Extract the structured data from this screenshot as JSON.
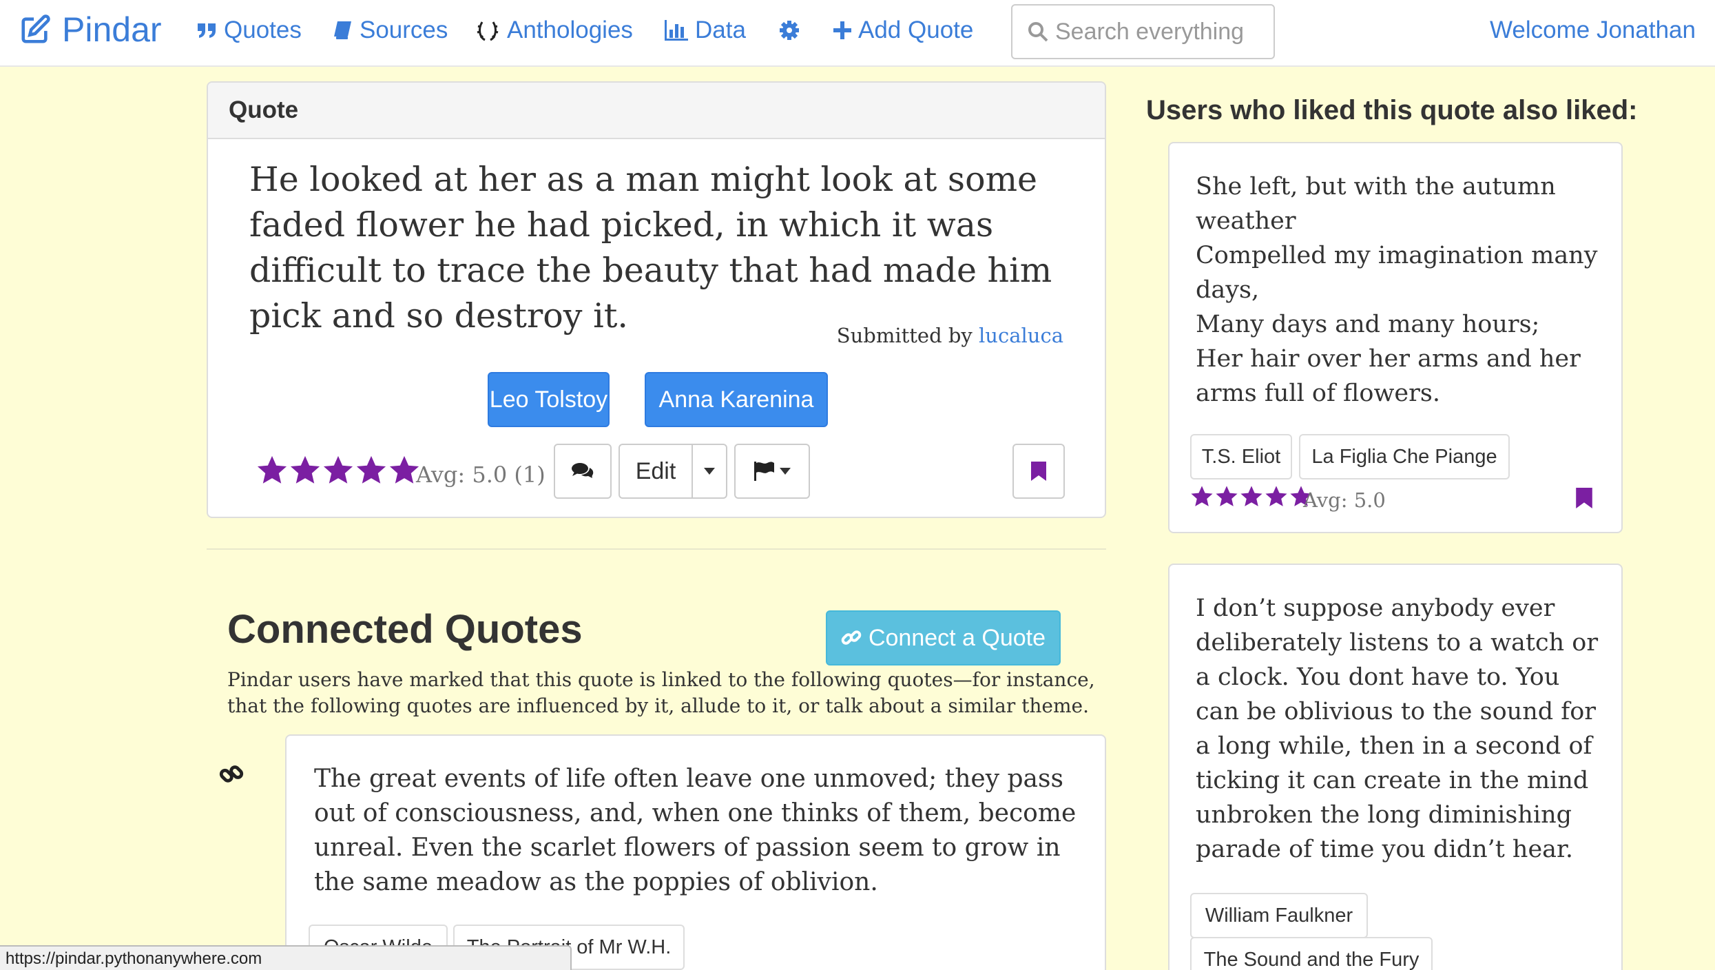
{
  "colors": {
    "link": "#3b7dd8",
    "primary": "#3b8ced",
    "info": "#5bc0de",
    "star": "#7b1fa2",
    "background": "#fefdd6"
  },
  "nav": {
    "brand": "Pindar",
    "brand_icon": "edit-icon",
    "items": [
      {
        "label": "Quotes",
        "icon": "quote-icon"
      },
      {
        "label": "Sources",
        "icon": "book-icon"
      },
      {
        "label": "Anthologies",
        "icon": "laurel-icon"
      },
      {
        "label": "Data",
        "icon": "bar-chart-icon"
      },
      {
        "label": "",
        "icon": "gear-icon"
      },
      {
        "label": "Add Quote",
        "icon": "plus-icon"
      }
    ],
    "search_placeholder": "Search everything",
    "welcome": "Welcome Jonathan"
  },
  "quote": {
    "heading": "Quote",
    "text": "He looked at her as a man might look at some faded flower he had picked, in which it was difficult to trace the beauty that had made him pick and so destroy it.",
    "submitted_prefix": "Submitted by",
    "submitted_user": "lucaluca",
    "author_tag": "Leo Tolstoy",
    "work_tag": "Anna Karenina",
    "rating": 5,
    "avg_text": "Avg: 5.0 (1)",
    "edit_label": "Edit"
  },
  "connected": {
    "title": "Connected Quotes",
    "connect_button": "Connect a Quote",
    "description": "Pindar users have marked that this quote is linked to the following quotes—for instance, that the following quotes are influenced by it, allude to it, or talk about a similar theme.",
    "items": [
      {
        "text": "The great events of life often leave one unmoved; they pass out of consciousness, and, when one thinks of them, become unreal. Even the scarlet flowers of passion seem to grow in the same meadow as the poppies of oblivion.",
        "author": "Oscar Wilde",
        "work": "The Portrait of Mr W.H."
      }
    ]
  },
  "sidebar": {
    "title": "Users who liked this quote also liked:",
    "cards": [
      {
        "lines": [
          "She left, but with the autumn weather",
          "Compelled my imagination many days,",
          "Many days and many hours;",
          "Her hair over her arms and her arms full of flowers."
        ],
        "author": "T.S. Eliot",
        "work": "La Figlia Che Piange",
        "rating": 5,
        "avg_text": "Avg: 5.0"
      },
      {
        "text": "I don’t suppose anybody ever deliberately listens to a watch or a clock. You dont have to. You can be oblivious to the sound for a long while, then in a second of ticking it can create in the mind unbroken the long diminishing parade of time you didn’t hear.",
        "author": "William Faulkner",
        "work": "The Sound and the Fury"
      }
    ]
  },
  "status_url": "https://pindar.pythonanywhere.com"
}
